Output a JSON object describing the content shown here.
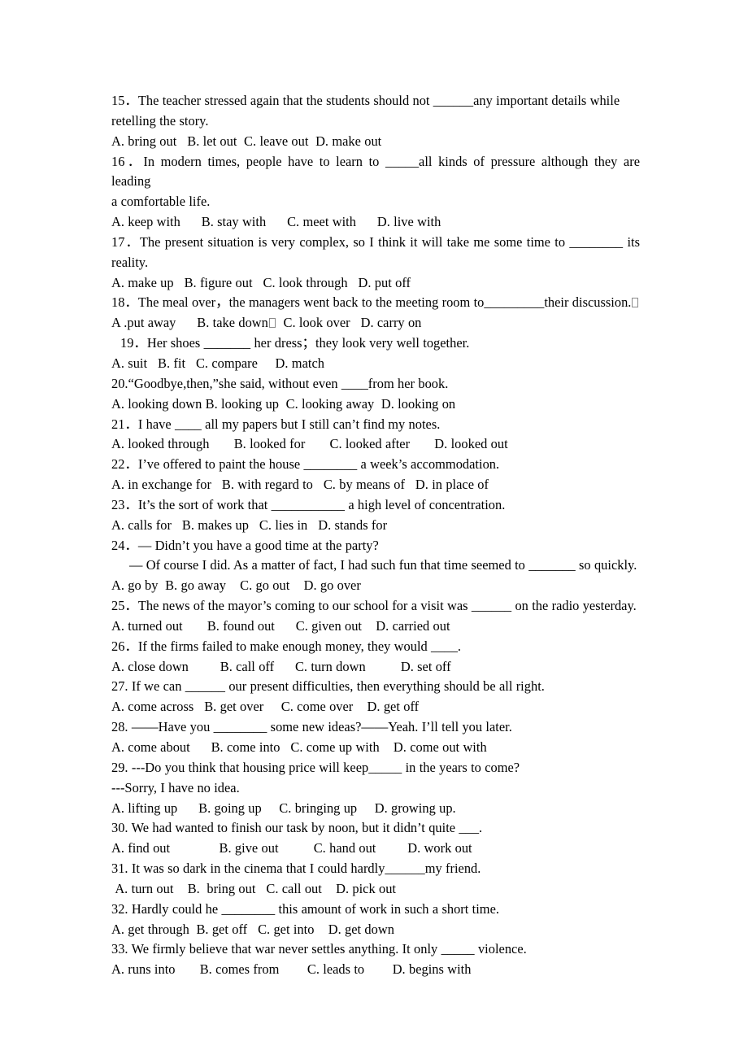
{
  "document": {
    "type": "english-grammar-worksheet",
    "background_color": "#ffffff",
    "text_color": "#000000",
    "questions": [
      {
        "number": "15",
        "stem": "15．The teacher stressed again that the students should not ______any important details while",
        "stem_cont": "retelling the story.",
        "options": "A. bring out   B. let out  C. leave out  D. make out"
      },
      {
        "number": "16",
        "stem": "16．In modern times, people have to learn to _____all kinds of pressure although they are leading",
        "stem_cont": "a comfortable life.",
        "options": "A. keep with      B. stay with      C. meet with      D. live with"
      },
      {
        "number": "17",
        "stem": "17．The present situation is very complex, so I think it will take me some time to ________ its",
        "stem_cont": "reality.",
        "options": "A. make up   B. figure out   C. look through   D. put off"
      },
      {
        "number": "18",
        "stem_a": "18．The meal over，the managers went back to the meeting room to_________their discussion.",
        "stem_b": "",
        "options_a": "A .put away      B. take down",
        "options_b": "  C. look over   D. carry on"
      },
      {
        "number": "19",
        "stem": "19．Her shoes _______ her dress；they look very well together.",
        "options": "A. suit   B. fit   C. compare     D. match"
      },
      {
        "number": "20",
        "stem": "20.“Goodbye,then,”she said, without even ____from her book.",
        "options": "A. looking down B. looking up  C. looking away  D. looking on"
      },
      {
        "number": "21",
        "stem": "21．I have ____ all my papers but I still can’t find my notes.",
        "options": "A. looked through       B. looked for       C. looked after       D. looked out"
      },
      {
        "number": "22",
        "stem": "22．I’ve offered to paint the house ________ a week’s accommodation.",
        "options": "A. in exchange for   B. with regard to   C. by means of   D. in place of"
      },
      {
        "number": "23",
        "stem": "23．It’s the sort of work that ___________ a high level of concentration.",
        "options": "A. calls for   B. makes up   C. lies in   D. stands for"
      },
      {
        "number": "24",
        "stem": "24．— Didn’t you have a good time at the party?",
        "stem_cont": "— Of course I did. As a matter of fact, I had such fun that time seemed to _______ so quickly.",
        "options": "A. go by  B. go away    C. go out    D. go over"
      },
      {
        "number": "25",
        "stem": "25．The news of the mayor’s coming to our school for a visit was ______ on the radio yesterday.",
        "options": "A. turned out       B. found out      C. given out    D. carried out"
      },
      {
        "number": "26",
        "stem": "26．If the firms failed to make enough money, they would ____.",
        "options": "A. close down         B. call off      C. turn down          D. set off"
      },
      {
        "number": "27",
        "stem": "27. If we can ______ our present difficulties, then everything should be all right.",
        "options": "A. come across   B. get over     C. come over    D. get off"
      },
      {
        "number": "28",
        "stem": "28. ——Have you ________ some new ideas?——Yeah. I’ll tell you later.",
        "options": "A. come about      B. come into   C. come up with    D. come out with"
      },
      {
        "number": "29",
        "stem": "29. ---Do you think that housing price will keep_____ in the years to come?",
        "stem_cont": "---Sorry, I have no idea.",
        "options": "A. lifting up      B. going up     C. bringing up     D. growing up."
      },
      {
        "number": "30",
        "stem": "30. We had wanted to finish our task by noon, but it didn’t quite ___.",
        "options": "A. find out              B. give out          C. hand out         D. work out"
      },
      {
        "number": "31",
        "stem": "31. It was so dark in the cinema that I could hardly______my friend.",
        "options": " A. turn out    B.  bring out   C. call out    D. pick out"
      },
      {
        "number": "32",
        "stem": "32. Hardly could he ________ this amount of work in such a short time.",
        "options": "A. get through  B. get off   C. get into    D. get down"
      },
      {
        "number": "33",
        "stem": "33. We firmly believe that war never settles anything. It only _____ violence.",
        "options": "A. runs into       B. comes from        C. leads to        D. begins with"
      }
    ]
  }
}
